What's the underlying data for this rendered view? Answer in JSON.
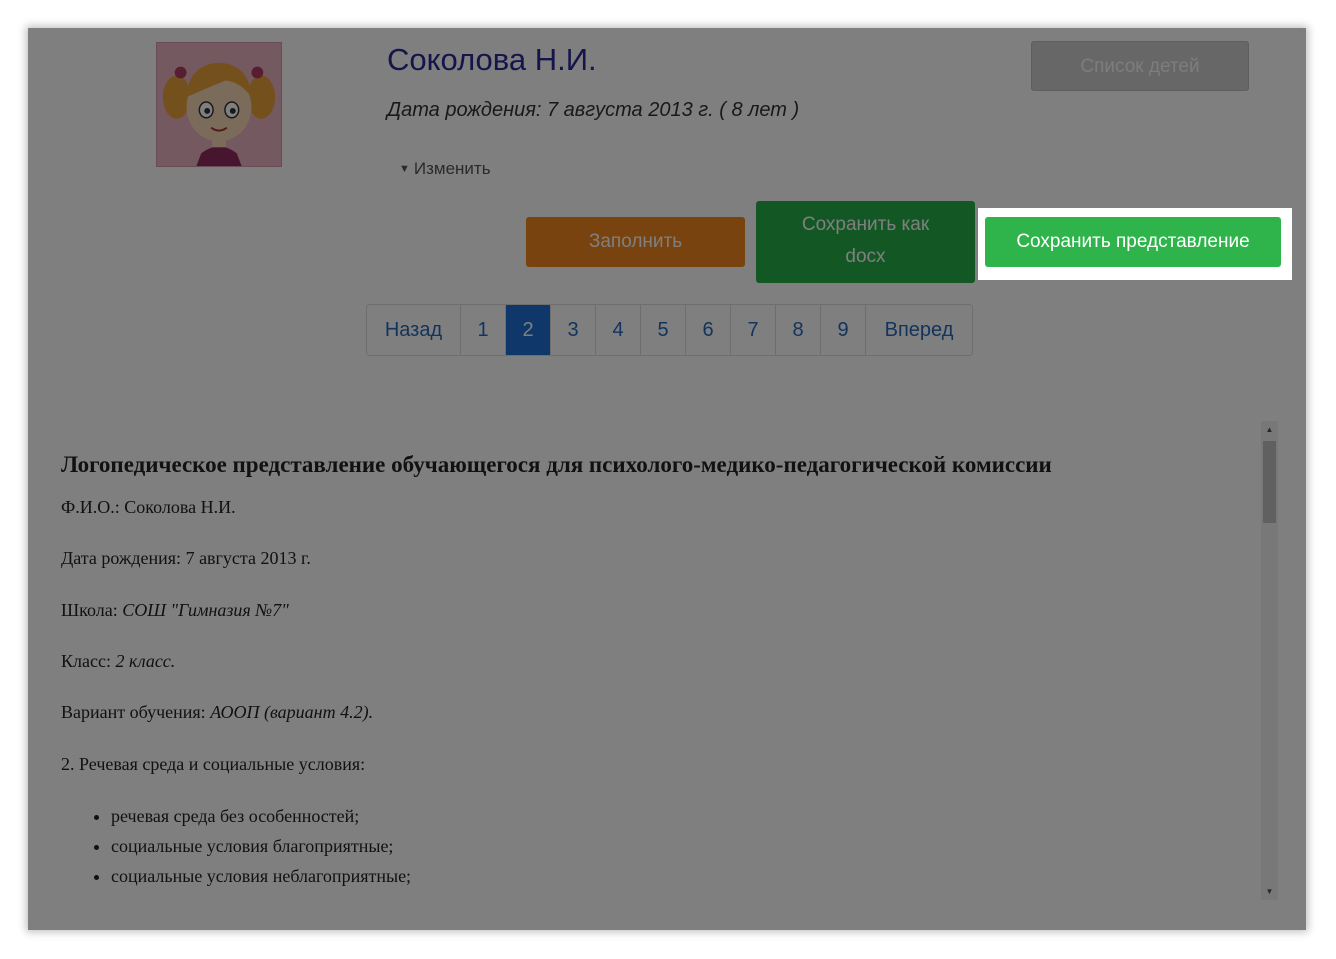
{
  "profile": {
    "name": "Соколова Н.И.",
    "birth_line": "Дата рождения: 7 августа 2013 г. ( 8 лет )",
    "edit_label": "Изменить"
  },
  "buttons": {
    "children_list": "Список детей",
    "fill": "Заполнить",
    "save_docx_line1": "Сохранить как",
    "save_docx_line2": "docx",
    "save_presentation": "Сохранить представление"
  },
  "pagination": {
    "prev": "Назад",
    "pages": [
      "1",
      "2",
      "3",
      "4",
      "5",
      "6",
      "7",
      "8",
      "9"
    ],
    "active": "2",
    "next": "Вперед"
  },
  "document": {
    "title": "Логопедическое представление обучающегося для психолого-медико-педагогической комиссии",
    "fio_label": "Ф.И.О.: ",
    "fio_value": "Соколова Н.И.",
    "dob_label": "Дата рождения: ",
    "dob_value": "7 августа 2013 г.",
    "school_label": "Школа: ",
    "school_value": "СОШ \"Гимназия №7\"",
    "class_label": "Класс: ",
    "class_value": "2 класс.",
    "variant_label": "Вариант обучения: ",
    "variant_value": "АООП (вариант 4.2).",
    "section2": "2. Речевая среда и социальные условия:",
    "bullets": [
      "речевая среда без особенностей;",
      "социальные условия благоприятные;",
      "социальные условия неблагоприятные;"
    ]
  },
  "colors": {
    "fill_button": "#f0861c",
    "save_button": "#2fb44c",
    "active_page": "#1f6fd4",
    "name_color": "#2a2a96"
  }
}
